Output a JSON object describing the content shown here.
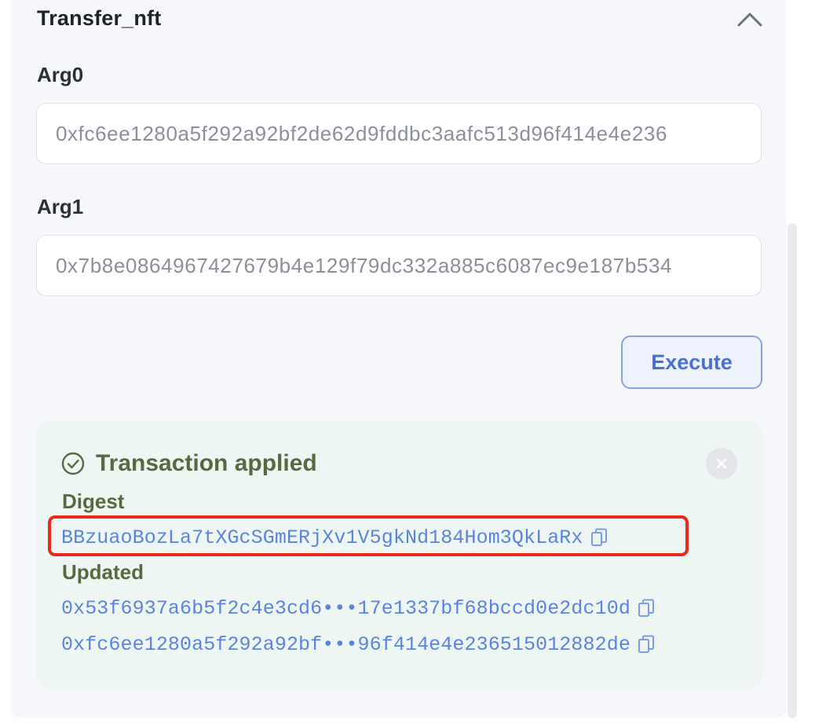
{
  "function": {
    "title": "Transfer_nft",
    "collapse_icon": "chevron-up-icon"
  },
  "args": [
    {
      "label": "Arg0",
      "value": "0xfc6ee1280a5f292a92bf2de62d9fddbc3aafc513d96f414e4e236"
    },
    {
      "label": "Arg1",
      "value": "0x7b8e0864967427679b4e129f79dc332a885c6087ec9e187b534"
    }
  ],
  "execute_label": "Execute",
  "result": {
    "status_icon": "check-circle-icon",
    "title": "Transaction applied",
    "close_icon": "close-icon",
    "digest_label": "Digest",
    "digest": "BBzuaoBozLa7tXGcSGmERjXv1V5gkNd184Hom3QkLaRx",
    "updated_label": "Updated",
    "updated": [
      "0x53f6937a6b5f2c4e3cd6•••17e1337bf68bccd0e2dc10d",
      "0xfc6ee1280a5f292a92bf•••96f414e4e236515012882de"
    ]
  },
  "colors": {
    "accent": "#4a6fd1",
    "link": "#5b82e0",
    "success": "#556b3f",
    "success_bg": "#eef6f3",
    "highlight": "#e8291c"
  }
}
